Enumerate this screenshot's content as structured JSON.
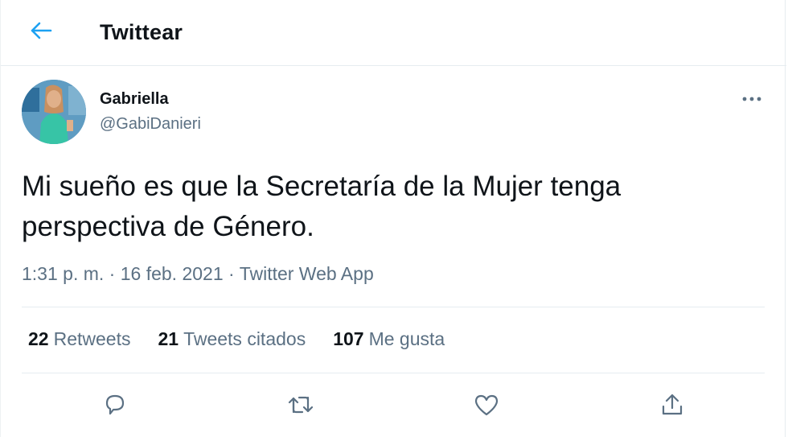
{
  "header": {
    "title": "Twittear"
  },
  "tweet": {
    "author_name": "Gabriella",
    "author_handle": "@GabiDanieri",
    "text_line1": "Mi sueño es que la Secretaría de la Mujer tenga",
    "text_line2": "perspectiva de Género.",
    "time": "1:31 p. m.",
    "date": "16 feb. 2021",
    "separator": "·",
    "source": "Twitter Web App"
  },
  "stats": {
    "retweets_count": "22",
    "retweets_label": "Retweets",
    "quotes_count": "21",
    "quotes_label": "Tweets citados",
    "likes_count": "107",
    "likes_label": "Me gusta"
  },
  "icons": {
    "back": "back-arrow-icon",
    "more": "more-dots-icon",
    "reply": "reply-icon",
    "retweet": "retweet-icon",
    "like": "heart-icon",
    "share": "share-icon"
  },
  "colors": {
    "accent": "#1da1f2",
    "secondary_text": "#5b7083",
    "primary_text": "#0f1419",
    "divider": "#e6ecf0"
  }
}
